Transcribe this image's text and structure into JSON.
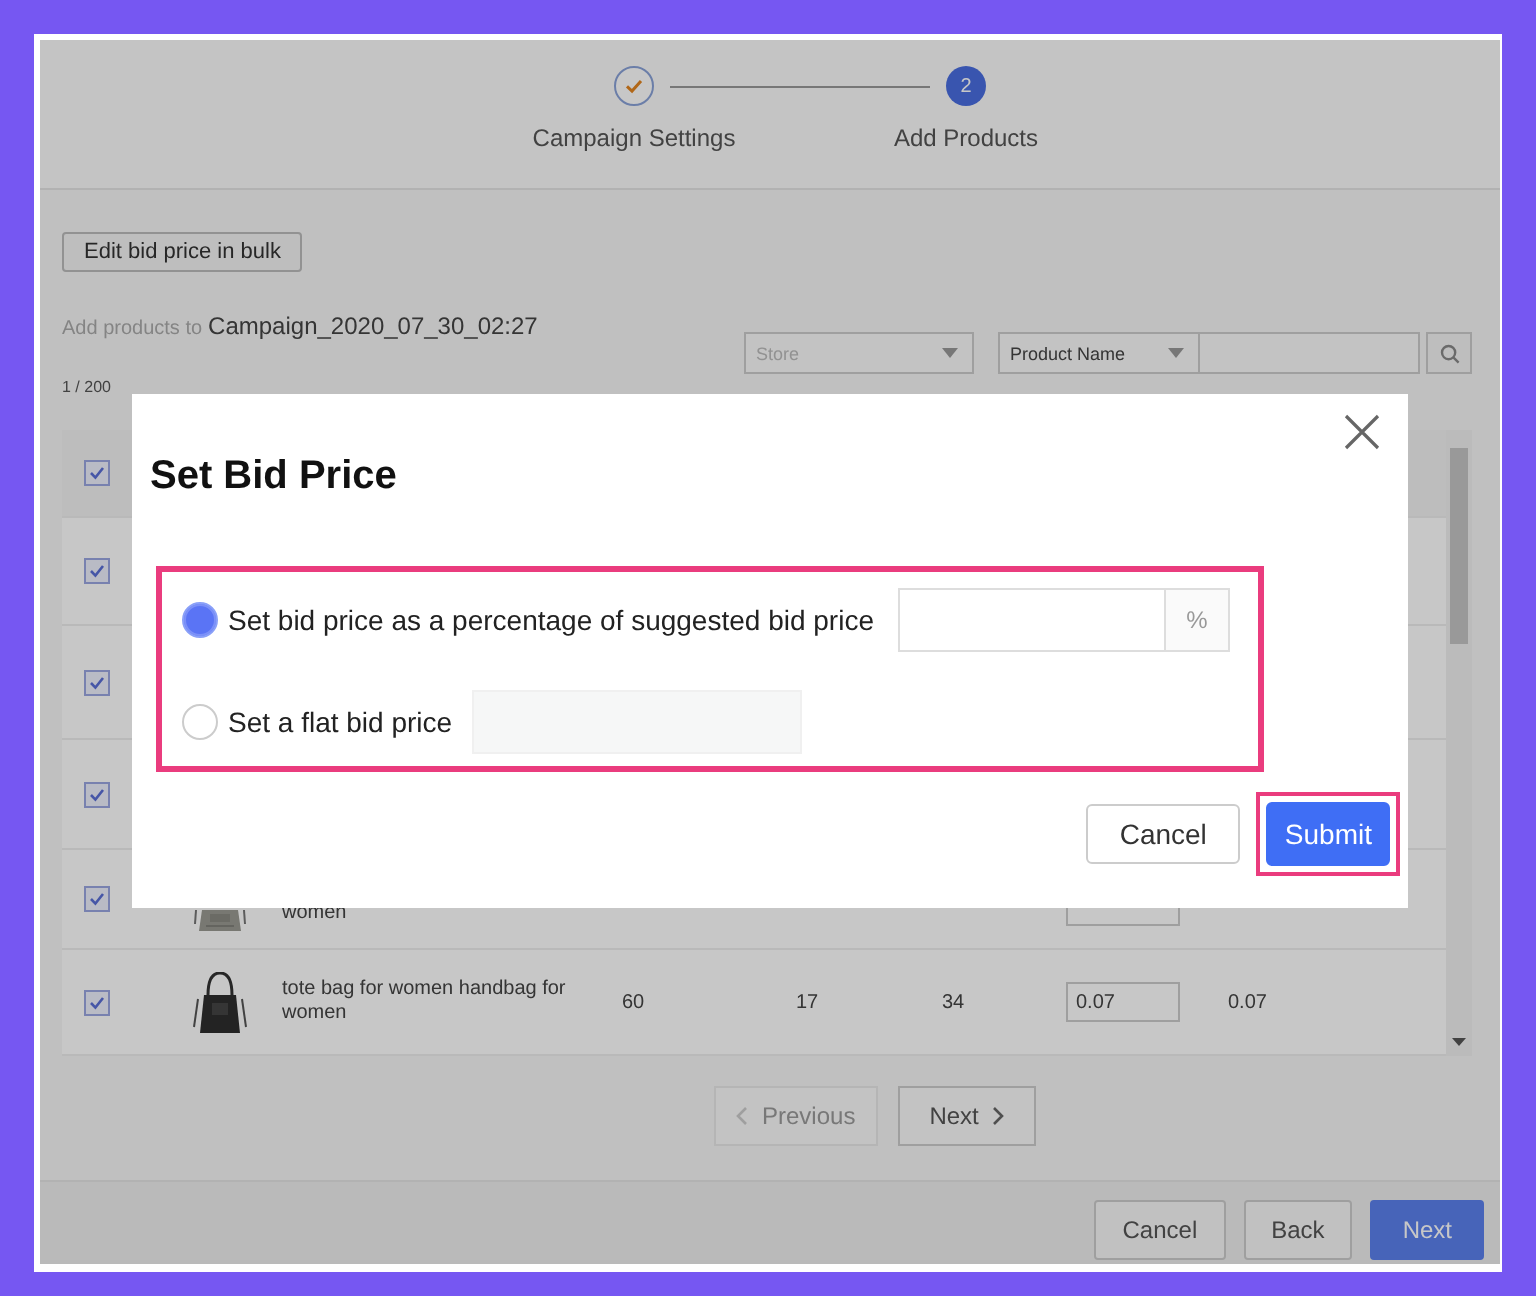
{
  "stepper": [
    {
      "label": "Campaign Settings",
      "completed": true
    },
    {
      "label": "Add Products",
      "number": "2",
      "completed": false
    }
  ],
  "bulk_button": "Edit bid price in bulk",
  "add_products": {
    "label": "Add products to",
    "campaign": "Campaign_2020_07_30_02:27"
  },
  "filters": {
    "store": {
      "placeholder": "Store"
    },
    "field": {
      "value": "Product Name"
    }
  },
  "count": "1 / 200",
  "table": {
    "header": {
      "checked": true
    },
    "rows": [
      {
        "kind": "hidden",
        "checked": true
      },
      {
        "kind": "hidden",
        "checked": true
      },
      {
        "kind": "hidden",
        "checked": true
      },
      {
        "kind": "partial",
        "checked": true,
        "name": "women"
      },
      {
        "kind": "full",
        "checked": true,
        "name": "tote bag for women handbag for women",
        "col_1": "60",
        "col_2": "17",
        "col_3": "34",
        "bid": "0.07",
        "col_4": "0.07"
      }
    ]
  },
  "pagination": [
    {
      "label": "Previous",
      "disabled": true
    },
    {
      "label": "Next",
      "disabled": false
    }
  ],
  "footer_buttons": [
    {
      "label": "Cancel",
      "primary": false
    },
    {
      "label": "Back",
      "primary": false
    },
    {
      "label": "Next",
      "primary": true
    }
  ],
  "modal": {
    "title": "Set Bid Price",
    "options_highlighted": true,
    "options": [
      {
        "label": "Set bid price as a percentage of suggested bid price",
        "selected": true,
        "suffix": "%"
      },
      {
        "label": "Set a flat bid price",
        "selected": false
      }
    ],
    "buttons": [
      {
        "label": "Cancel",
        "primary": false,
        "highlighted": false
      },
      {
        "label": "Submit",
        "primary": true,
        "highlighted": true
      }
    ]
  }
}
